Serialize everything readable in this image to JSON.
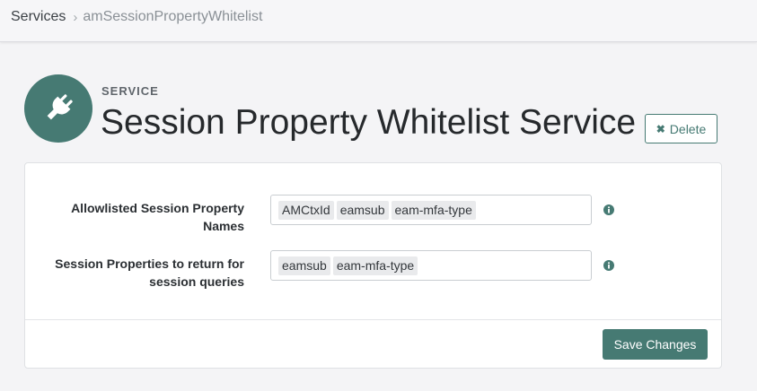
{
  "breadcrumb": {
    "parent": "Services",
    "separator": "›",
    "current": "amSessionPropertyWhitelist"
  },
  "header": {
    "icon": "plug-icon",
    "eyebrow": "SERVICE",
    "title": "Session Property Whitelist Service",
    "delete_label": "Delete",
    "delete_icon": "close-icon"
  },
  "form": {
    "fields": [
      {
        "label_line1": "Allowlisted Session Property",
        "label_line2": "Names",
        "tags": [
          "AMCtxId",
          "eamsub",
          "eam-mfa-type"
        ],
        "info_icon": "info-circle-icon"
      },
      {
        "label_line1": "Session Properties to return for",
        "label_line2": "session queries",
        "tags": [
          "eamsub",
          "eam-mfa-type"
        ],
        "info_icon": "info-circle-icon"
      }
    ],
    "save_label": "Save Changes"
  },
  "colors": {
    "accent": "#467a73",
    "background": "#f4f4f6",
    "card": "#ffffff"
  }
}
